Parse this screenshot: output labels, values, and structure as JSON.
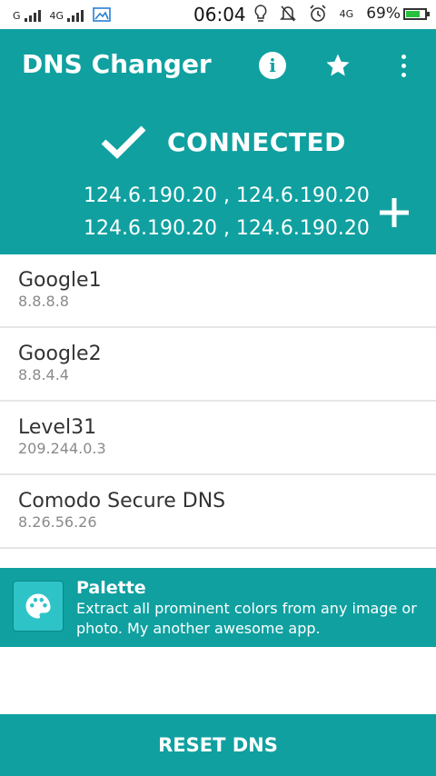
{
  "status_bar": {
    "carrier1": "G",
    "carrier2": "4G",
    "time": "06:04",
    "network": "4G",
    "battery": "69%",
    "battery_level": 0.69,
    "battery_color": "#27c23d"
  },
  "app_bar": {
    "title": "DNS Changer",
    "color": "#10a0a0",
    "actions": [
      "info-icon",
      "star-icon",
      "more-vert-icon"
    ]
  },
  "connection": {
    "status": "CONNECTED",
    "dns_line1": "124.6.190.20 , 124.6.190.20",
    "dns_line2": "124.6.190.20 , 124.6.190.20"
  },
  "servers": [
    {
      "name": "Google1",
      "ip": "8.8.8.8"
    },
    {
      "name": "Google2",
      "ip": "8.8.4.4"
    },
    {
      "name": "Level31",
      "ip": "209.244.0.3"
    },
    {
      "name": "Comodo Secure DNS",
      "ip": "8.26.56.26"
    }
  ],
  "promo": {
    "title": "Palette",
    "description": "Extract all prominent colors from any image or photo. My another awesome app."
  },
  "reset_label": "RESET DNS"
}
